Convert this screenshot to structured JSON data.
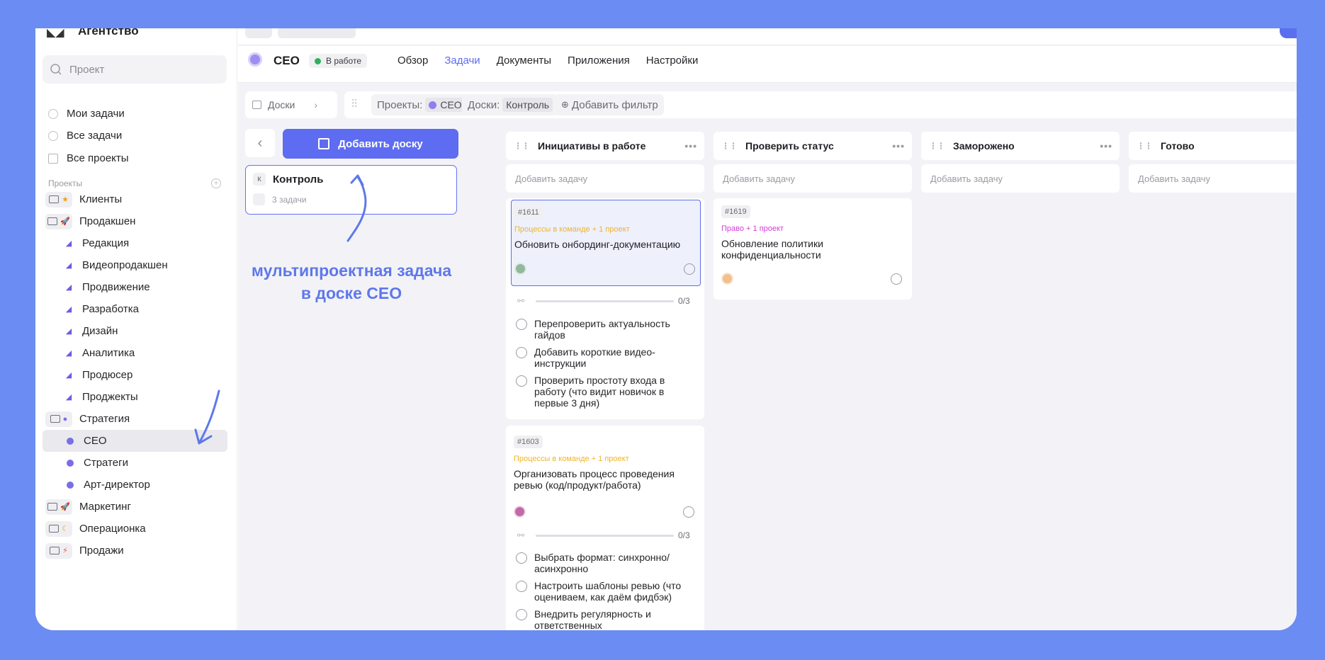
{
  "sidebar": {
    "brand": "Агентство",
    "search_placeholder": "Проект",
    "nav": [
      "Мои задачи",
      "Все задачи",
      "Все проекты"
    ],
    "section_title": "Проекты",
    "projects": [
      {
        "label": "Клиенты",
        "type": "group",
        "icon": "star-icon"
      },
      {
        "label": "Продакшен",
        "type": "group",
        "icon": "rocket-icon"
      },
      {
        "label": "Редакция",
        "type": "sub"
      },
      {
        "label": "Видеопродакшен",
        "type": "sub"
      },
      {
        "label": "Продвижение",
        "type": "sub"
      },
      {
        "label": "Разработка",
        "type": "sub"
      },
      {
        "label": "Дизайн",
        "type": "sub"
      },
      {
        "label": "Аналитика",
        "type": "sub"
      },
      {
        "label": "Продюсер",
        "type": "sub"
      },
      {
        "label": "Проджекты",
        "type": "sub"
      },
      {
        "label": "Стратегия",
        "type": "group",
        "icon": "globe-icon"
      },
      {
        "label": "CEO",
        "type": "dot",
        "active": true
      },
      {
        "label": "Стратеги",
        "type": "dot"
      },
      {
        "label": "Арт-директор",
        "type": "dot"
      },
      {
        "label": "Маркетинг",
        "type": "group",
        "icon": "rocket-icon"
      },
      {
        "label": "Операционка",
        "type": "group",
        "icon": "moon-icon"
      },
      {
        "label": "Продажи",
        "type": "group",
        "icon": "lightning-icon"
      }
    ]
  },
  "header": {
    "project": "CEO",
    "status": "В работе",
    "tabs": [
      "Обзор",
      "Задачи",
      "Документы",
      "Приложения",
      "Настройки"
    ],
    "active_tab": "Задачи"
  },
  "toolbar": {
    "boards_label": "Доски",
    "filter_projects_label": "Проекты:",
    "filter_projects_value": "CEO",
    "filter_boards_label": "Доски:",
    "filter_boards_value": "Контроль",
    "add_filter": "Добавить фильтр"
  },
  "boards_panel": {
    "add_board": "Добавить доску",
    "board": {
      "badge": "К",
      "title": "Контроль",
      "count": "3 задачи"
    },
    "annotation_line1": "мультипроектная задача",
    "annotation_line2": "в доске CEO"
  },
  "columns": [
    {
      "title": "Инициативы в работе",
      "add_task": "Добавить задачу"
    },
    {
      "title": "Проверить статус",
      "add_task": "Добавить задачу"
    },
    {
      "title": "Заморожено",
      "add_task": "Добавить задачу"
    },
    {
      "title": "Готово",
      "add_task": "Добавить задачу"
    }
  ],
  "cards": {
    "c1611": {
      "id": "#1611",
      "projects": "Процессы в команде + 1 проект",
      "title": "Обновить онбординг-документацию",
      "progress": "0/3",
      "progress_fraction": 0,
      "subtasks": [
        "Перепроверить актуальность гайдов",
        "Добавить короткие видео-инструкции",
        "Проверить простоту входа в работу (что видит новичок в первые 3 дня)"
      ]
    },
    "c1603": {
      "id": "#1603",
      "projects": "Процессы в команде + 1 проект",
      "title": "Организовать процесс проведения ревью (код/продукт/работа)",
      "progress": "0/3",
      "progress_fraction": 0,
      "subtasks": [
        "Выбрать формат: синхронно/ асинхронно",
        "Настроить шаблоны ревью (что оцениваем, как даём фидбэк)",
        "Внедрить регулярность и ответственных"
      ]
    },
    "c1619": {
      "id": "#1619",
      "projects": "Право + 1 проект",
      "title": "Обновление политики конфиденциальности"
    }
  },
  "colors": {
    "background": "#6b8cf2",
    "accent": "#5d6cf1",
    "tag_orange": "#f0b429",
    "tag_pink": "#d63ad9",
    "annotation": "#5e78ea"
  }
}
